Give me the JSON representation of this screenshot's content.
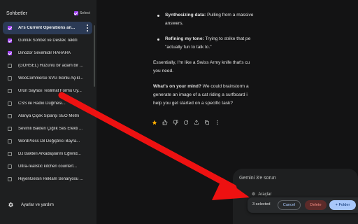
{
  "sidebar": {
    "title": "Sohbetler",
    "select_label": "Select",
    "items": [
      {
        "label": "AI's Current Operations an...",
        "checked": true,
        "active": true
      },
      {
        "label": "Günlük Sohbet ve Destek Teklifi",
        "checked": true,
        "active": false
      },
      {
        "label": "Dinozor Sevimlidir HAHAHA",
        "checked": true,
        "active": false
      },
      {
        "label": "(GÖRSEL) Hüzünlü bir adam bir ...",
        "checked": false,
        "active": false
      },
      {
        "label": "WooCommerce SVG İkonlu Açıkl...",
        "checked": false,
        "active": false
      },
      {
        "label": "Ürün Sayfası Teslimat Formu Uy...",
        "checked": false,
        "active": false
      },
      {
        "label": "CSS ile Radio Düğmesi...",
        "checked": false,
        "active": false
      },
      {
        "label": "Alanya Çiçek Siparişi SEO Metni",
        "checked": false,
        "active": false
      },
      {
        "label": "Sevimli Bakteri Çığlık Ses Efekti ...",
        "checked": false,
        "active": false
      },
      {
        "label": "WordPress Dil Değiştirici Bayra...",
        "checked": false,
        "active": false
      },
      {
        "label": "DJ Bakteri Arkadaşlarını Eğlend...",
        "checked": false,
        "active": false
      },
      {
        "label": "Ultra-realistic kitchen countert...",
        "checked": false,
        "active": false
      },
      {
        "label": "HijyenGelsin Reklam Senaryosu ...",
        "checked": false,
        "active": false
      }
    ],
    "footer_label": "Ayarlar ve yardım"
  },
  "content": {
    "bullet1_title": "Synthesizing data:",
    "bullet1_line1": " Pulling from a massive",
    "bullet1_line2": "answers.",
    "bullet2_title": "Refining my tone:",
    "bullet2_line1": " Trying to strike that pe",
    "bullet2_line2": "\"actually fun to talk to.\"",
    "para1_line1": "Essentially, I'm like a Swiss Army knife that's cu",
    "para1_line2": "you need.",
    "para2_title": "What's on your mind?",
    "para2_line1": " We could brainstorm a",
    "para2_line2": "generate an image of a cat riding a surfboard i",
    "para2_line3": "help you get started on a specific task?"
  },
  "input": {
    "placeholder": "Gemini 3'e sorun",
    "tools_label": "Araçlar"
  },
  "selection_bar": {
    "count_label": "3 selected",
    "cancel_label": "Cancel",
    "delete_label": "Delete",
    "folder_label": "+ Folder"
  },
  "colors": {
    "accent_purple": "#a142f4",
    "active_item_bg": "#2b3a55",
    "folder_button_bg": "#a8c7fa",
    "delete_button_bg": "#5c2b29",
    "arrow_red": "#ee1111",
    "star_gold": "#f9ab00"
  },
  "icons": {
    "more": "more-vert-icon",
    "settings": "gear-icon",
    "actions": [
      "star-icon",
      "thumb-up-icon",
      "thumb-down-icon",
      "refresh-icon",
      "share-icon",
      "copy-icon",
      "more-vert-icon"
    ]
  }
}
